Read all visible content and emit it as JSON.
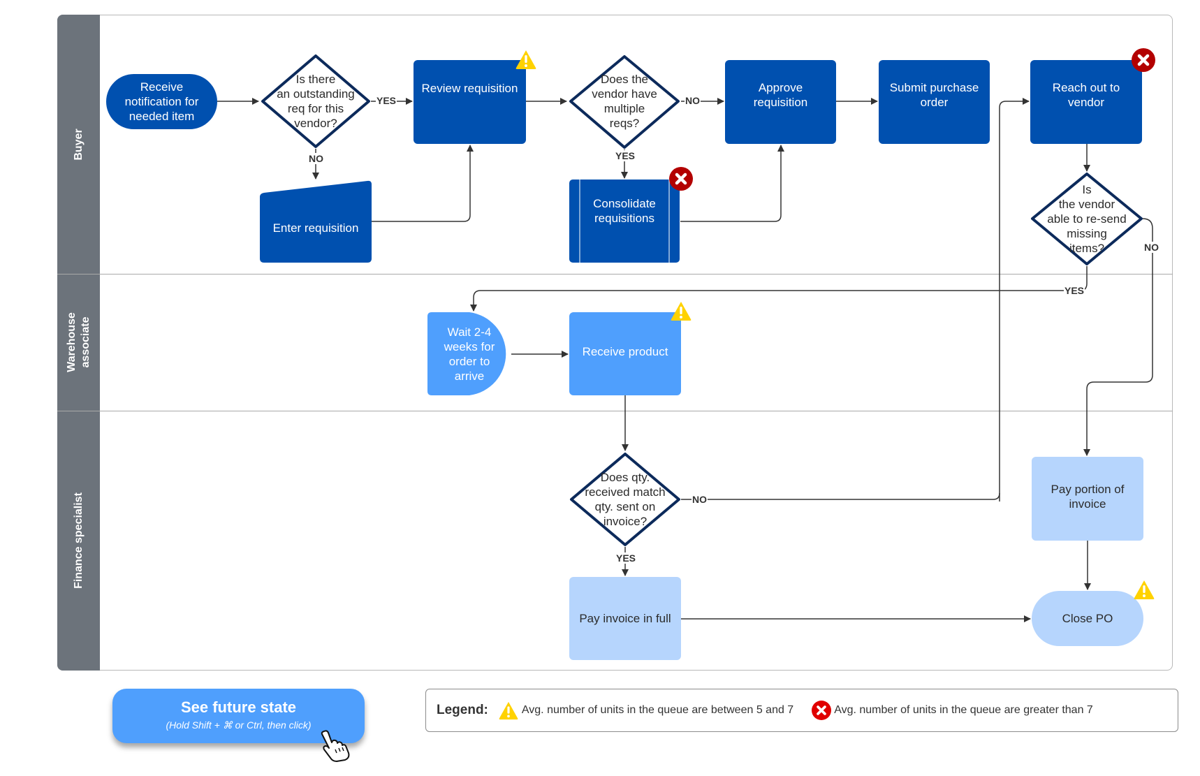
{
  "lanes": [
    {
      "id": "buyer",
      "label": "Buyer"
    },
    {
      "id": "warehouse",
      "label": "Warehouse\nassociate"
    },
    {
      "id": "finance",
      "label": "Finance specialist"
    }
  ],
  "nodes": {
    "receive_notification": {
      "label": "Receive\nnotification for\nneeded item",
      "shape": "terminator"
    },
    "outstanding_req": {
      "label": "Is there\nan outstanding\nreq for this\nvendor?",
      "shape": "decision"
    },
    "review_requisition": {
      "label": "Review requisition",
      "shape": "process",
      "badge": "warning"
    },
    "enter_requisition": {
      "label": "Enter requisition",
      "shape": "manual-input"
    },
    "multiple_reqs": {
      "label": "Does the\nvendor have\nmultiple\nreqs?",
      "shape": "decision"
    },
    "consolidate_requisitions": {
      "label": "Consolidate\nrequisitions",
      "shape": "predefined-process",
      "badge": "error"
    },
    "approve_requisition": {
      "label": "Approve\nrequisition",
      "shape": "process"
    },
    "submit_purchase_order": {
      "label": "Submit purchase\norder",
      "shape": "process"
    },
    "reach_out_vendor": {
      "label": "Reach out to\nvendor",
      "shape": "process",
      "badge": "error"
    },
    "vendor_resend": {
      "label": "Is\nthe vendor\nable to re-send\nmissing\nitems?",
      "shape": "decision"
    },
    "wait_weeks": {
      "label": "Wait 2-4\nweeks for\norder to\narrive",
      "shape": "delay"
    },
    "receive_product": {
      "label": "Receive product",
      "shape": "process",
      "badge": "warning"
    },
    "qty_match": {
      "label": "Does qty.\nreceived match\nqty. sent on\ninvoice?",
      "shape": "decision"
    },
    "pay_full": {
      "label": "Pay invoice in full",
      "shape": "process"
    },
    "pay_portion": {
      "label": "Pay portion of\ninvoice",
      "shape": "process"
    },
    "close_po": {
      "label": "Close PO",
      "shape": "terminator",
      "badge": "warning"
    }
  },
  "edge_labels": {
    "outstanding_yes": "YES",
    "outstanding_no": "NO",
    "multiple_no": "NO",
    "multiple_yes": "YES",
    "resend_no": "NO",
    "resend_yes": "YES",
    "qty_no": "NO",
    "qty_yes": "YES"
  },
  "future_button": {
    "title": "See future state",
    "hint": "(Hold Shift + ⌘ or Ctrl, then click)"
  },
  "legend": {
    "title": "Legend:",
    "warning_text": "Avg. number of units in the queue are between 5 and  7",
    "error_text": "Avg. number of units in the queue are greater than 7"
  },
  "colors": {
    "lane_header": "#6c737b",
    "dark_blue": "#0050af",
    "mid_blue": "#4f9ffd",
    "light_blue": "#b6d5fd",
    "decision_border": "#0c2a5b",
    "warning": "#ffd200",
    "error": "#b30000"
  }
}
